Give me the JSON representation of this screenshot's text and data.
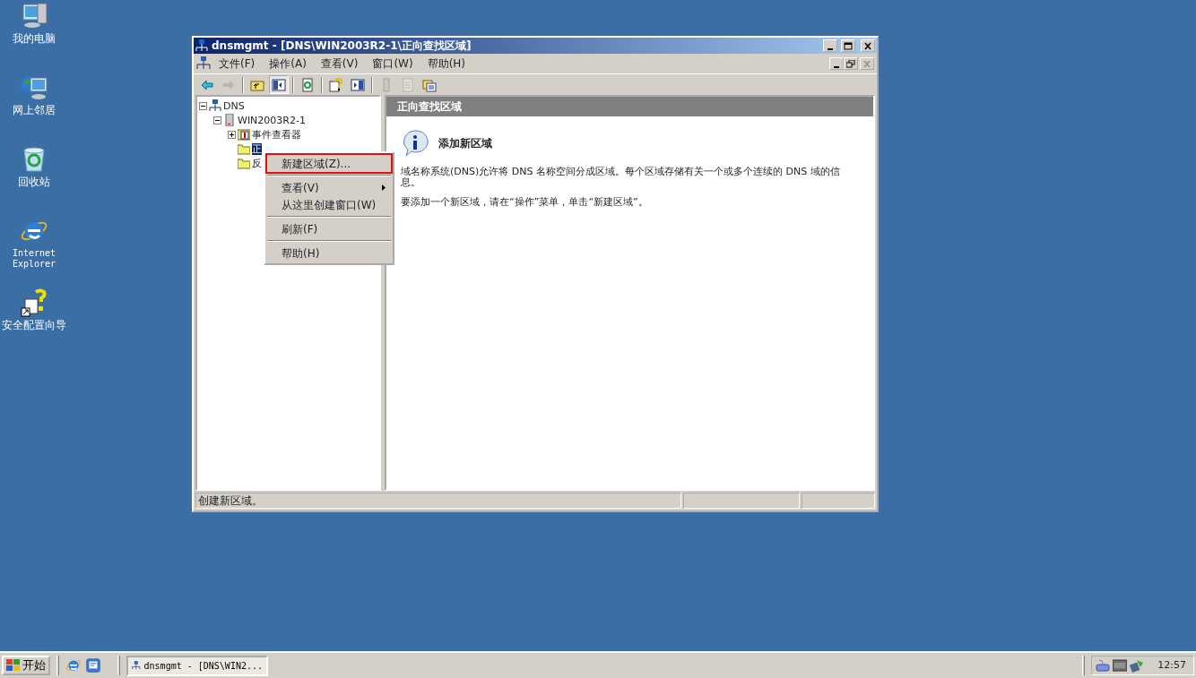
{
  "desktop_icons": [
    {
      "kind": "computer",
      "label": "我的电脑"
    },
    {
      "kind": "network",
      "label": "网上邻居"
    },
    {
      "kind": "recycle",
      "label": "回收站"
    },
    {
      "kind": "browser",
      "label": "Internet Explorer"
    },
    {
      "kind": "wizard",
      "label": "安全配置向导"
    }
  ],
  "window": {
    "title": "dnsmgmt - [DNS\\WIN2003R2-1\\正向查找区域]",
    "menus": [
      "文件(F)",
      "操作(A)",
      "查看(V)",
      "窗口(W)",
      "帮助(H)"
    ],
    "toolbar": [
      {
        "kind": "back",
        "disabled": false,
        "pressed": false
      },
      {
        "kind": "forward",
        "disabled": true,
        "pressed": false
      },
      {
        "kind": "sep"
      },
      {
        "kind": "up",
        "disabled": false,
        "pressed": false
      },
      {
        "kind": "tree",
        "disabled": false,
        "pressed": true
      },
      {
        "kind": "sep"
      },
      {
        "kind": "refresh",
        "disabled": false,
        "pressed": false
      },
      {
        "kind": "sep"
      },
      {
        "kind": "help",
        "disabled": false,
        "pressed": false
      },
      {
        "kind": "pane",
        "disabled": false,
        "pressed": false
      },
      {
        "kind": "sep"
      },
      {
        "kind": "server",
        "disabled": true,
        "pressed": false
      },
      {
        "kind": "list",
        "disabled": true,
        "pressed": false
      },
      {
        "kind": "folders",
        "disabled": false,
        "pressed": false
      }
    ],
    "tree": [
      {
        "label": "DNS",
        "kind": "dns",
        "expanded": true,
        "selected": false,
        "children": [
          {
            "label": "WIN2003R2-1",
            "kind": "server",
            "expanded": true,
            "selected": false,
            "children": [
              {
                "label": "事件查看器",
                "kind": "events",
                "expanded": false,
                "selected": false
              },
              {
                "label": "正",
                "kind": "folder",
                "selected": true
              },
              {
                "label": "反",
                "kind": "folder",
                "selected": false
              }
            ]
          }
        ]
      }
    ],
    "pane_header": "正向查找区域",
    "info_title": "添加新区域",
    "paragraphs": [
      "域名称系统(DNS)允许将 DNS 名称空间分成区域。每个区域存储有关一个或多个连续的 DNS 域的信息。",
      "要添加一个新区域，请在“操作”菜单，单击“新建区域”。"
    ],
    "status": "创建新区域。"
  },
  "context_menu": [
    {
      "kind": "item",
      "label": "新建区域(Z)...",
      "outlined": true,
      "submenu": false
    },
    {
      "kind": "separator"
    },
    {
      "kind": "item",
      "label": "查看(V)",
      "outlined": false,
      "submenu": true
    },
    {
      "kind": "item",
      "label": "从这里创建窗口(W)",
      "outlined": false,
      "submenu": false
    },
    {
      "kind": "separator"
    },
    {
      "kind": "item",
      "label": "刷新(F)",
      "outlined": false,
      "submenu": false
    },
    {
      "kind": "separator"
    },
    {
      "kind": "item",
      "label": "帮助(H)",
      "outlined": false,
      "submenu": false
    }
  ],
  "taskbar": {
    "start": "开始",
    "quick_launch": [
      {
        "kind": "browser"
      },
      {
        "kind": "desktop"
      }
    ],
    "tasks": [
      {
        "label": "dnsmgmt - [DNS\\WIN2...",
        "selected": true
      }
    ],
    "tray": [
      {
        "kind": "keyboard"
      },
      {
        "kind": "vm"
      },
      {
        "kind": "network"
      }
    ],
    "time": "12:57"
  }
}
